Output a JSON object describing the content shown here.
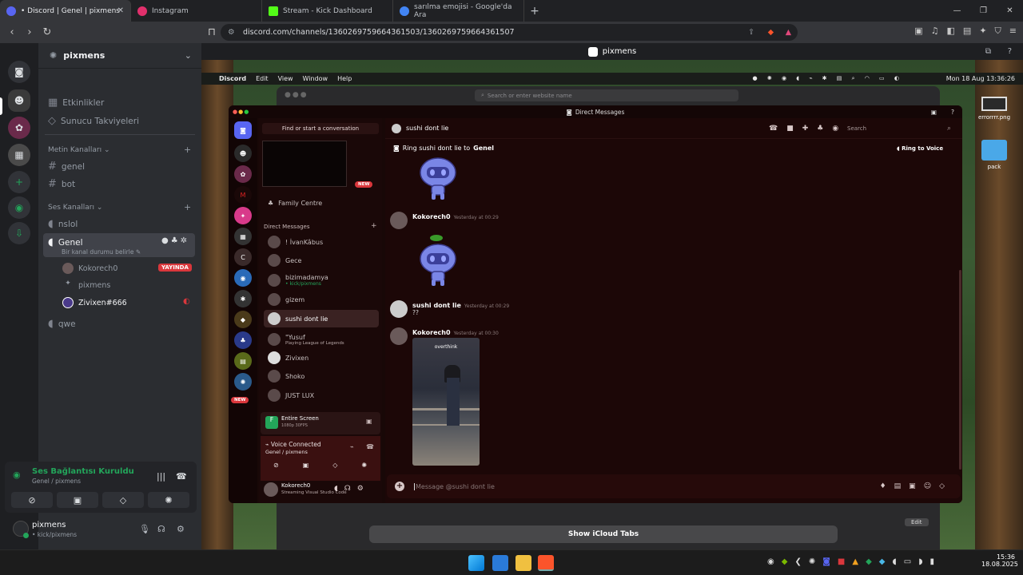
{
  "browser": {
    "tabs": [
      {
        "label": "• Discord | Genel | pixmens",
        "color": "#5865f2"
      },
      {
        "label": "Instagram",
        "color": "#e1306c"
      },
      {
        "label": "Stream - Kick Dashboard",
        "color": "#53fc18"
      },
      {
        "label": "sarılma emojisi - Google'da Ara",
        "color": "#4285f4"
      }
    ],
    "url": "discord.com/channels/1360269759664361503/1360269759664361507"
  },
  "discord": {
    "server_name": "pixmens",
    "window_title": "pixmens",
    "top_items": [
      "Etkinlikler",
      "Sunucu Takviyeleri"
    ],
    "text_category": "Metin Kanalları",
    "text_channels": [
      "genel",
      "bot"
    ],
    "voice_category": "Ses Kanalları",
    "voice_channels": [
      "nslol",
      "Genel",
      "qwe"
    ],
    "active_voice": "Genel",
    "channel_status": "Bir kanal durumu belirle",
    "voice_users": [
      {
        "name": "Kokorech0",
        "badge": "YAYINDA"
      },
      {
        "name": "pixmens",
        "badge": ""
      },
      {
        "name": "Zivixen#666",
        "badge": ""
      }
    ],
    "voice_connected_title": "Ses Bağlantısı Kuruldu",
    "voice_connected_sub": "Genel / pixmens",
    "user_name": "pixmens",
    "user_status": "• kick/pixmens"
  },
  "mac": {
    "menubar": [
      "Discord",
      "Edit",
      "View",
      "Window",
      "Help"
    ],
    "clock": "Mon 18 Aug  13:36:26",
    "safari_search": "Search or enter website name",
    "icloud_tabs": "Show iCloud Tabs",
    "edit": "Edit",
    "desktop_items": [
      "errorrrr.png",
      "pack"
    ]
  },
  "dm": {
    "window_title": "Direct Messages",
    "search_convo": "Find or start a conversation",
    "new_badge": "NEW",
    "family_centre": "Family Centre",
    "dm_header": "Direct Messages",
    "dms": [
      {
        "name": "! İvanKâbus",
        "sub": ""
      },
      {
        "name": "Gece",
        "sub": ""
      },
      {
        "name": "bizimadamya",
        "sub": "• kick/pixmens"
      },
      {
        "name": "gizem",
        "sub": ""
      },
      {
        "name": "sushi dont lie",
        "sub": ""
      },
      {
        "name": "\"Yusuf",
        "sub": "Playing League of Legends"
      },
      {
        "name": "Zivixen",
        "sub": ""
      },
      {
        "name": "Shoko",
        "sub": ""
      },
      {
        "name": "JUST LUX",
        "sub": ""
      }
    ],
    "stream_title": "Entire Screen",
    "stream_sub": "1080p 30FPS",
    "voice_title": "Voice Connected",
    "voice_sub": "Genel / pixmens",
    "me_name": "Kokorech0",
    "me_status": "Streaming Visual Studio Code",
    "chat_user": "sushi dont lie",
    "search": "Search",
    "ring_text": "Ring sushi dont lie to",
    "ring_target": "Genel",
    "ring_button": "Ring to Voice",
    "messages": [
      {
        "author": "Kokorech0",
        "time": "Yesterday at 00:29"
      },
      {
        "author": "sushi dont lie",
        "time": "Yesterday at 00:29",
        "text": "??"
      },
      {
        "author": "Kokorech0",
        "time": "Yesterday at 00:30",
        "caption": "overthink"
      }
    ],
    "composer_placeholder": "Message @sushi dont lie"
  },
  "taskbar": {
    "time": "15:36",
    "date": "18.08.2025"
  }
}
